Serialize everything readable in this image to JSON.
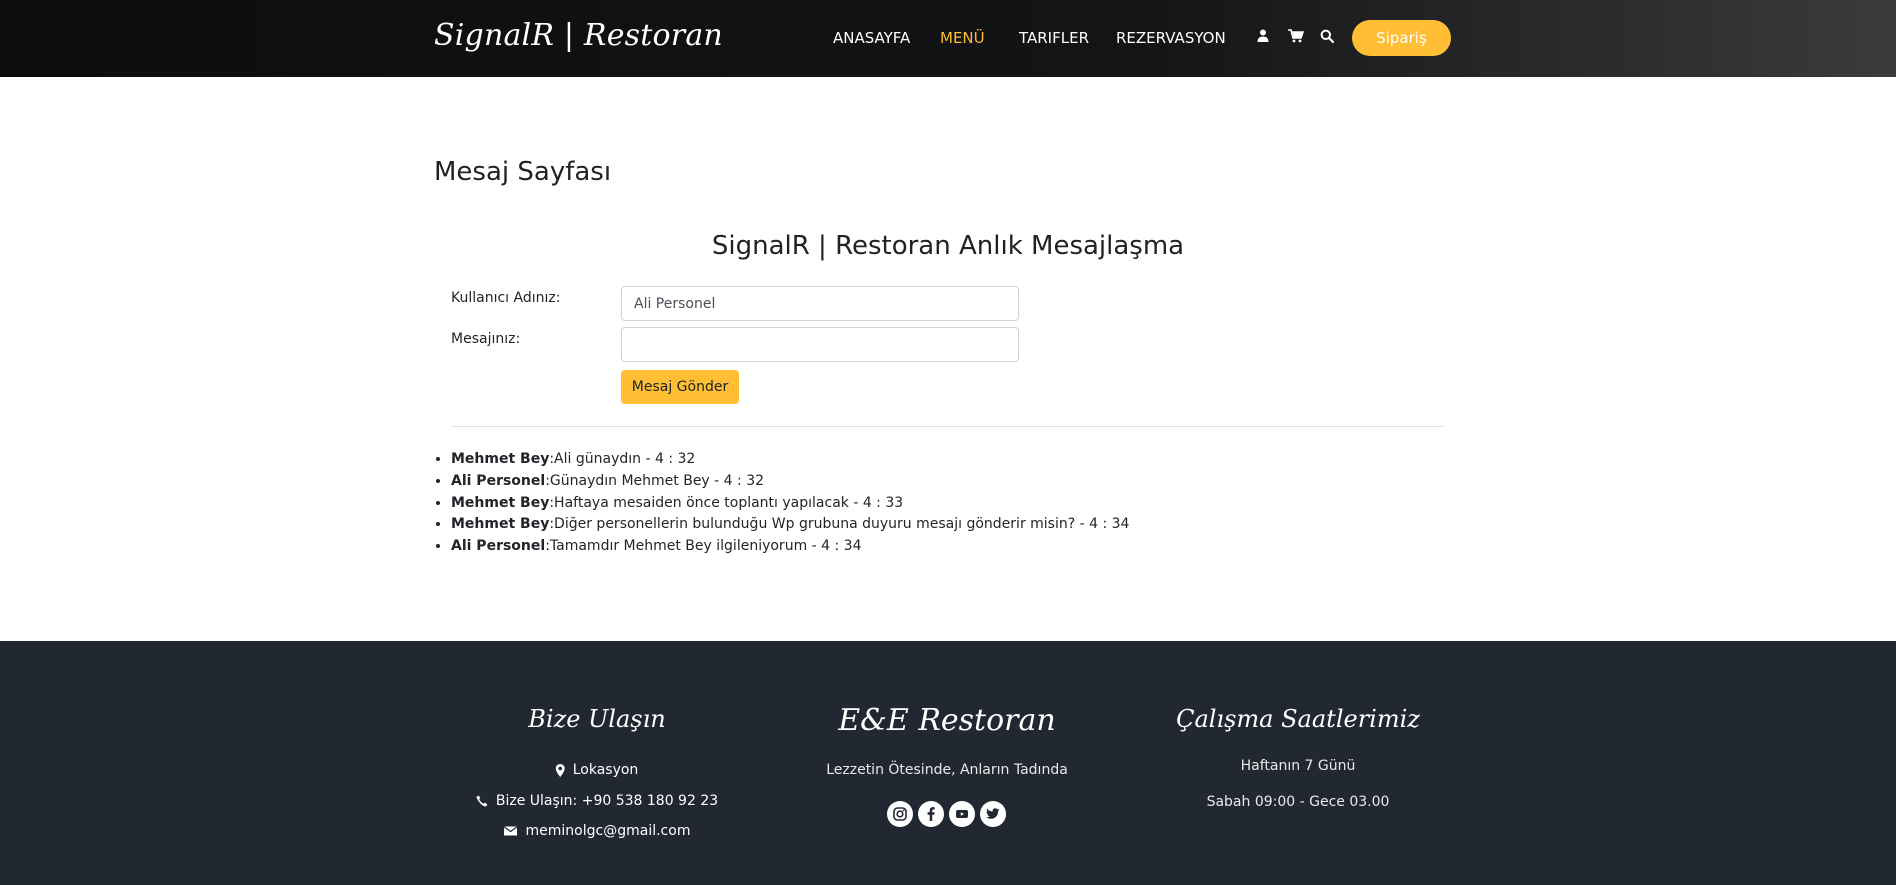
{
  "header": {
    "brand": "SignalR | Restoran",
    "nav": [
      {
        "label": "ANASAYFA",
        "active": false
      },
      {
        "label": "MENÜ",
        "active": true
      },
      {
        "label": "TARIFLER",
        "active": false
      },
      {
        "label": "REZERVASYON",
        "active": false
      }
    ],
    "icons": [
      "user-icon",
      "cart-icon",
      "search-icon"
    ],
    "order_button": "Sipariş"
  },
  "main": {
    "page_title": "Mesaj Sayfası",
    "chat_title": "SignalR | Restoran Anlık Mesajlaşma",
    "username_label": "Kullanıcı Adınız:",
    "username_value": "Ali Personel",
    "message_label": "Mesajınız:",
    "message_value": "",
    "send_button": "Mesaj Gönder",
    "messages": [
      {
        "user": "Mehmet Bey",
        "text": ":Ali günaydın - 4 : 32"
      },
      {
        "user": "Ali Personel",
        "text": ":Günaydın Mehmet Bey - 4 : 32"
      },
      {
        "user": "Mehmet Bey",
        "text": ":Haftaya mesaiden önce toplantı yapılacak - 4 : 33"
      },
      {
        "user": "Mehmet Bey",
        "text": ":Diğer personellerin bulunduğu Wp grubuna duyuru mesajı gönderir misin? - 4 : 34"
      },
      {
        "user": "Ali Personel",
        "text": ":Tamamdır Mehmet Bey ilgileniyorum - 4 : 34"
      }
    ]
  },
  "footer": {
    "contact_title": "Bize Ulaşın",
    "location": "Lokasyon",
    "phone": "Bize Ulaşın: +90 538 180 92 23",
    "email": "meminolgc@gmail.com",
    "restaurant_title": "E&E Restoran",
    "slogan": "Lezzetin Ötesinde, Anların Tadında",
    "social": [
      "instagram-icon",
      "facebook-icon",
      "youtube-icon",
      "twitter-icon"
    ],
    "hours_title": "Çalışma Saatlerimiz",
    "hours_days": "Haftanın 7 Günü",
    "hours_time": "Sabah 09:00 - Gece 03.00"
  },
  "colors": {
    "accent": "#ffbe33",
    "header_bg": "#0c0d0e",
    "footer_bg": "#222831"
  }
}
